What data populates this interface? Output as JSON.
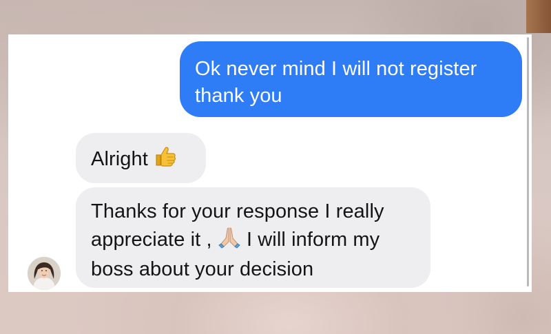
{
  "conversation": {
    "messages": [
      {
        "sender": "me",
        "text": "Ok never mind I will not register thank you"
      },
      {
        "sender": "contact",
        "text": "Alright",
        "emoji": "thumbs-up-icon"
      },
      {
        "sender": "contact",
        "text_before": "Thanks for your response I really appreciate it ,",
        "emoji": "folded-hands-icon",
        "text_after": "I will inform my boss about your decision"
      }
    ]
  },
  "colors": {
    "sent_bubble": "#2e7cf6",
    "received_bubble": "#eeeef1",
    "panel_background": "#ffffff"
  }
}
